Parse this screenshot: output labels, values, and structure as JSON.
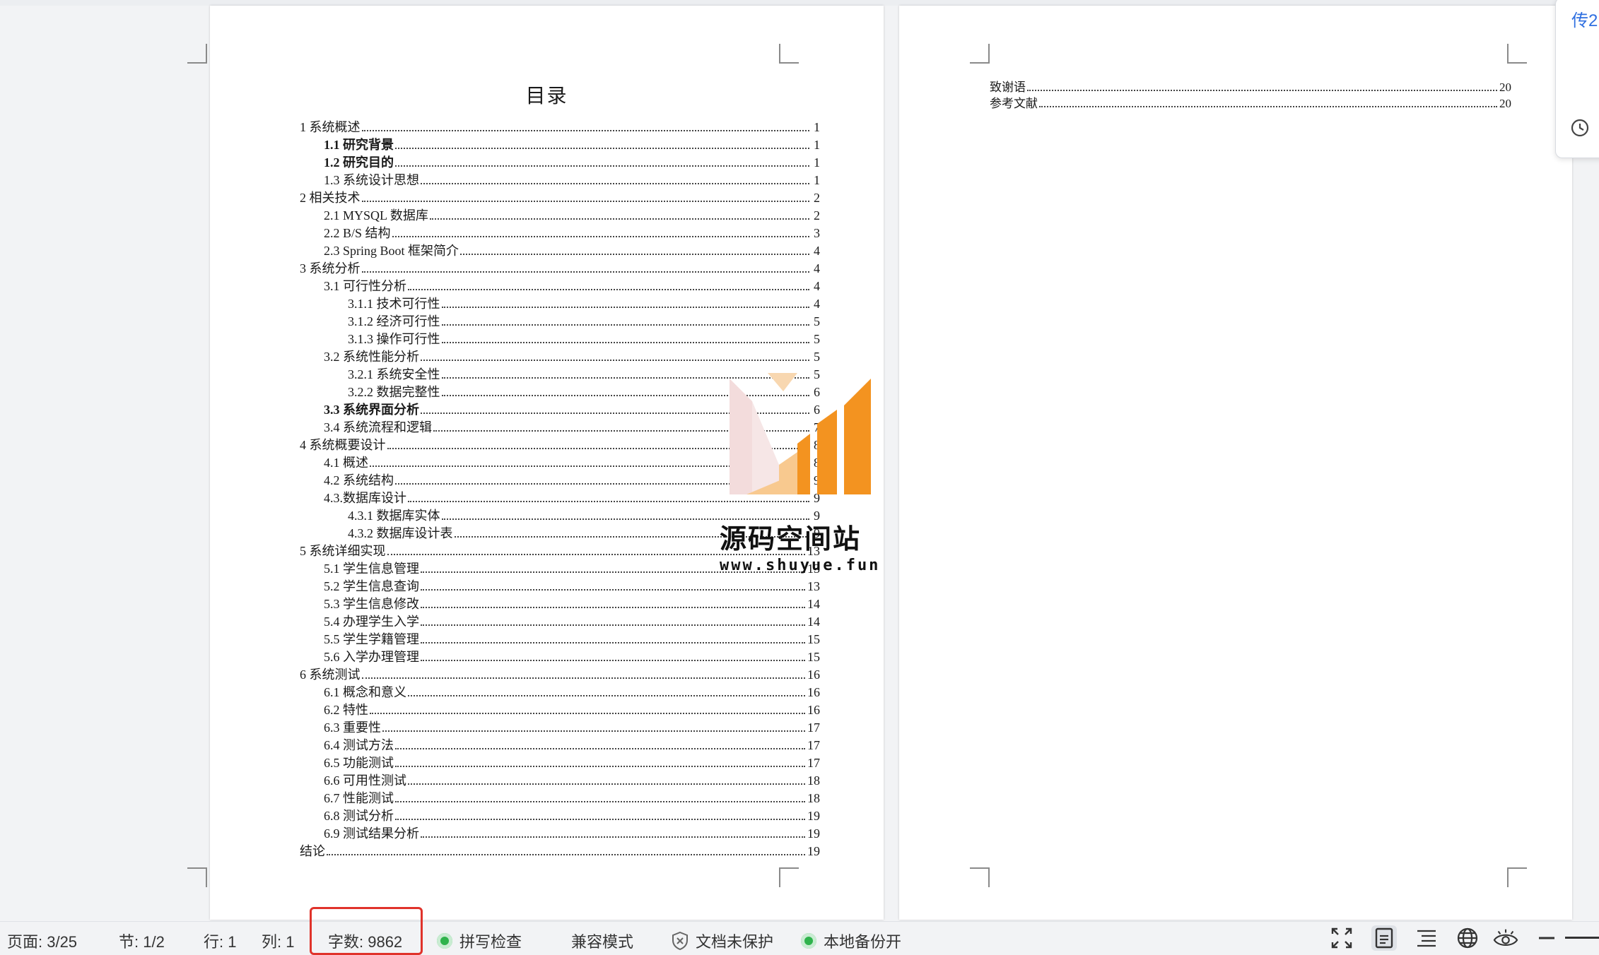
{
  "toc": {
    "title": "目录",
    "entries": [
      {
        "label": "1 系统概述",
        "page": "1",
        "level": 1,
        "bold": false
      },
      {
        "label": "1.1  研究背景",
        "page": "1",
        "level": 2,
        "bold": true
      },
      {
        "label": "1.2 研究目的",
        "page": "1",
        "level": 2,
        "bold": true
      },
      {
        "label": "1.3 系统设计思想",
        "page": "1",
        "level": 2,
        "bold": false
      },
      {
        "label": "2 相关技术",
        "page": "2",
        "level": 1,
        "bold": false
      },
      {
        "label": "2.1 MYSQL 数据库",
        "page": "2",
        "level": 2,
        "bold": false
      },
      {
        "label": "2.2 B/S 结构",
        "page": "3",
        "level": 2,
        "bold": false
      },
      {
        "label": "2.3 Spring Boot 框架简介",
        "page": "4",
        "level": 2,
        "bold": false
      },
      {
        "label": "3 系统分析",
        "page": "4",
        "level": 1,
        "bold": false
      },
      {
        "label": "3.1 可行性分析",
        "page": "4",
        "level": 2,
        "bold": false
      },
      {
        "label": "3.1.1 技术可行性",
        "page": "4",
        "level": 3,
        "bold": false
      },
      {
        "label": "3.1.2 经济可行性",
        "page": "5",
        "level": 3,
        "bold": false
      },
      {
        "label": "3.1.3 操作可行性",
        "page": "5",
        "level": 3,
        "bold": false
      },
      {
        "label": "3.2 系统性能分析",
        "page": "5",
        "level": 2,
        "bold": false
      },
      {
        "label": "3.2.1  系统安全性",
        "page": "5",
        "level": 3,
        "bold": false
      },
      {
        "label": "3.2.2  数据完整性",
        "page": "6",
        "level": 3,
        "bold": false
      },
      {
        "label": "3.3 系统界面分析",
        "page": "6",
        "level": 2,
        "bold": true
      },
      {
        "label": "3.4 系统流程和逻辑",
        "page": "7",
        "level": 2,
        "bold": false
      },
      {
        "label": "4 系统概要设计",
        "page": "8",
        "level": 1,
        "bold": false
      },
      {
        "label": "4.1 概述",
        "page": "8",
        "level": 2,
        "bold": false
      },
      {
        "label": "4.2 系统结构",
        "page": "9",
        "level": 2,
        "bold": false
      },
      {
        "label": "4.3.数据库设计",
        "page": "9",
        "level": 2,
        "bold": false
      },
      {
        "label": "4.3.1 数据库实体",
        "page": "9",
        "level": 3,
        "bold": false
      },
      {
        "label": "4.3.2 数据库设计表",
        "page": "9",
        "level": 3,
        "bold": false
      },
      {
        "label": "5 系统详细实现",
        "page": "13",
        "level": 1,
        "bold": false
      },
      {
        "label": "5.1  学生信息管理",
        "page": "13",
        "level": 2,
        "bold": false
      },
      {
        "label": "5.2  学生信息查询",
        "page": "13",
        "level": 2,
        "bold": false
      },
      {
        "label": "5.3  学生信息修改",
        "page": "14",
        "level": 2,
        "bold": false
      },
      {
        "label": "5.4  办理学生入学",
        "page": "14",
        "level": 2,
        "bold": false
      },
      {
        "label": "5.5  学生学籍管理",
        "page": "15",
        "level": 2,
        "bold": false
      },
      {
        "label": "5.6  入学办理管理",
        "page": "15",
        "level": 2,
        "bold": false
      },
      {
        "label": "6 系统测试",
        "page": "16",
        "level": 1,
        "bold": false
      },
      {
        "label": "6.1 概念和意义",
        "page": "16",
        "level": 2,
        "bold": false
      },
      {
        "label": "6.2 特性",
        "page": "16",
        "level": 2,
        "bold": false
      },
      {
        "label": "6.3 重要性",
        "page": "17",
        "level": 2,
        "bold": false
      },
      {
        "label": "6.4 测试方法",
        "page": "17",
        "level": 2,
        "bold": false
      },
      {
        "label": "6.5  功能测试",
        "page": "17",
        "level": 2,
        "bold": false
      },
      {
        "label": "6.6 可用性测试",
        "page": "18",
        "level": 2,
        "bold": false
      },
      {
        "label": "6.7 性能测试",
        "page": "18",
        "level": 2,
        "bold": false
      },
      {
        "label": "6.8 测试分析",
        "page": "19",
        "level": 2,
        "bold": false
      },
      {
        "label": "6.9 测试结果分析",
        "page": "19",
        "level": 2,
        "bold": false
      },
      {
        "label": "结论",
        "page": "19",
        "level": 1,
        "bold": false
      }
    ],
    "continued": [
      {
        "label": "致谢语",
        "page": "20"
      },
      {
        "label": "参考文献",
        "page": "20"
      }
    ]
  },
  "watermark": {
    "name": "源码空间站",
    "url": "www.shuyue.fun"
  },
  "side_panel": {
    "text": "传2"
  },
  "statusbar": {
    "page": "页面: 3/25",
    "section": "节: 1/2",
    "row": "行: 1",
    "col": "列: 1",
    "word_count": "字数: 9862",
    "spell_check": "拼写检查",
    "compat_mode": "兼容模式",
    "protect": "文档未保护",
    "backup": "本地备份开"
  },
  "colors": {
    "highlight": "#e0332b",
    "status_green": "#2fb34c",
    "watermark_orange": "#f39320",
    "panel_text": "#2f6fe0"
  },
  "icons": [
    "shield-x-icon",
    "fullscreen-icon",
    "page-view-icon",
    "outline-view-icon",
    "web-view-icon",
    "read-mode-icon",
    "zoom-out-icon",
    "clock-icon"
  ]
}
